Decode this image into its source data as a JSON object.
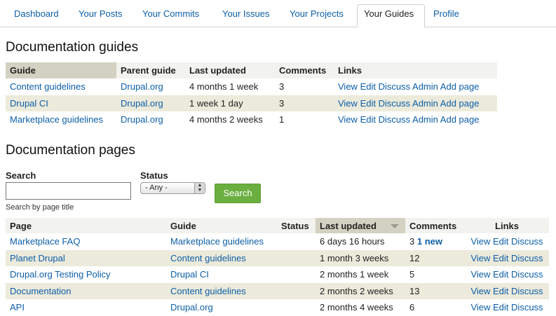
{
  "tabs": [
    {
      "label": "Dashboard"
    },
    {
      "label": "Your Posts"
    },
    {
      "label": "Your Commits"
    },
    {
      "label": "Your Issues"
    },
    {
      "label": "Your Projects"
    },
    {
      "label": "Your Guides"
    },
    {
      "label": "Profile"
    }
  ],
  "guides_section": {
    "title": "Documentation guides",
    "headers": [
      "Guide",
      "Parent guide",
      "Last updated",
      "Comments",
      "Links"
    ],
    "links": [
      "View",
      "Edit",
      "Discuss",
      "Admin",
      "Add page"
    ],
    "rows": [
      {
        "guide": "Content guidelines",
        "parent": "Drupal.org",
        "updated": "4 months 1 week",
        "comments": "3"
      },
      {
        "guide": "Drupal CI",
        "parent": "Drupal.org",
        "updated": "1 week 1 day",
        "comments": "3"
      },
      {
        "guide": "Marketplace guidelines",
        "parent": "Drupal.org",
        "updated": "4 months 2 weeks",
        "comments": "1"
      }
    ]
  },
  "pages_section": {
    "title": "Documentation pages",
    "search_label": "Search",
    "search_value": "",
    "search_desc": "Search by page title",
    "status_label": "Status",
    "status_value": "- Any -",
    "search_button": "Search",
    "headers": [
      "Page",
      "Guide",
      "Status",
      "Last updated",
      "Comments",
      "Links"
    ],
    "links": [
      "View",
      "Edit",
      "Discuss"
    ],
    "rows": [
      {
        "page": "Marketplace FAQ",
        "guide": "Marketplace guidelines",
        "status": "",
        "updated": "6 days 16 hours",
        "comments": "3",
        "new": "1 new"
      },
      {
        "page": "Planet Drupal",
        "guide": "Content guidelines",
        "status": "",
        "updated": "1 month 3 weeks",
        "comments": "12",
        "new": ""
      },
      {
        "page": "Drupal.org Testing Policy",
        "guide": "Drupal CI",
        "status": "",
        "updated": "2 months 1 week",
        "comments": "5",
        "new": ""
      },
      {
        "page": "Documentation",
        "guide": "Content guidelines",
        "status": "",
        "updated": "2 months 2 weeks",
        "comments": "13",
        "new": ""
      },
      {
        "page": "API",
        "guide": "Drupal.org",
        "status": "",
        "updated": "2 months 4 weeks",
        "comments": "6",
        "new": ""
      }
    ]
  },
  "colors": {
    "link": "#0d5fa8",
    "even_row": "#eceadb",
    "sorted_header": "#d3d2c2",
    "button": "#6aaf3f"
  }
}
